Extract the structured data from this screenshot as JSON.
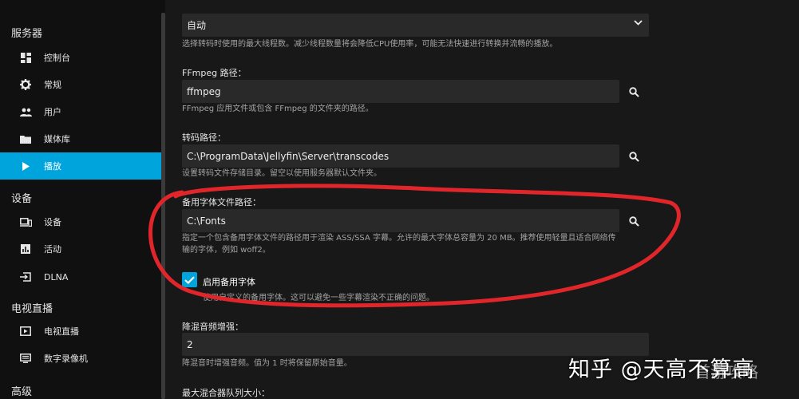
{
  "colors": {
    "accent": "#00a4dc",
    "sidebar_bg": "#101010",
    "content_bg": "#181818",
    "input_bg": "#292929",
    "annotation": "#e0262a"
  },
  "sidebar": {
    "sections": [
      {
        "title": "服务器",
        "items": [
          {
            "label": "控制台",
            "icon": "dashboard-icon"
          },
          {
            "label": "常规",
            "icon": "gear-icon"
          },
          {
            "label": "用户",
            "icon": "people-icon"
          },
          {
            "label": "媒体库",
            "icon": "folder-icon"
          },
          {
            "label": "播放",
            "icon": "play-icon",
            "active": true
          }
        ]
      },
      {
        "title": "设备",
        "items": [
          {
            "label": "设备",
            "icon": "devices-icon"
          },
          {
            "label": "活动",
            "icon": "assessment-icon"
          },
          {
            "label": "DLNA",
            "icon": "input-icon"
          }
        ]
      },
      {
        "title": "电视直播",
        "items": [
          {
            "label": "电视直播",
            "icon": "live-tv-icon"
          },
          {
            "label": "数字录像机",
            "icon": "dvr-icon"
          }
        ]
      },
      {
        "title": "高级",
        "items": []
      }
    ]
  },
  "content": {
    "thread_select": {
      "value": "自动",
      "help": "选择转码时使用的最大线程数。减少线程数量将会降低CPU使用率，可能无法快速进行转换并流畅的播放。"
    },
    "ffmpeg": {
      "label": "FFmpeg 路径：",
      "value": "ffmpeg",
      "help": "FFmpeg 应用文件或包含 FFmpeg 的文件夹的路径。"
    },
    "transcode": {
      "label": "转码路径：",
      "value": "C:\\ProgramData\\Jellyfin\\Server\\transcodes",
      "help": "设置转码文件存储目录。留空以使用服务器默认文件夹。"
    },
    "fallback_font": {
      "label": "备用字体文件路径：",
      "value": "C:\\Fonts",
      "help_line1": "指定一个包含备用字体文件的路径用于渲染 ASS/SSA 字幕。允许的最大字体总容量为 20 MB。推荐使用轻量且适合网络传",
      "help_line2": "输的字体，例如 woff2。"
    },
    "enable_fallback": {
      "label": "启用备用字体",
      "checked": true,
      "help": "使用自定义的备用字体。这可以避免一些字幕渲染不正确的问题。"
    },
    "downmix": {
      "label": "降混音频增强：",
      "value": "2",
      "help": "降混音时增强音频。值为 1 时将保留原始音量。"
    },
    "max_mux": {
      "label": "最大混合器队列大小："
    }
  },
  "watermark": {
    "text": "知乎 @天高不算高",
    "overlay": "首游攻略"
  }
}
